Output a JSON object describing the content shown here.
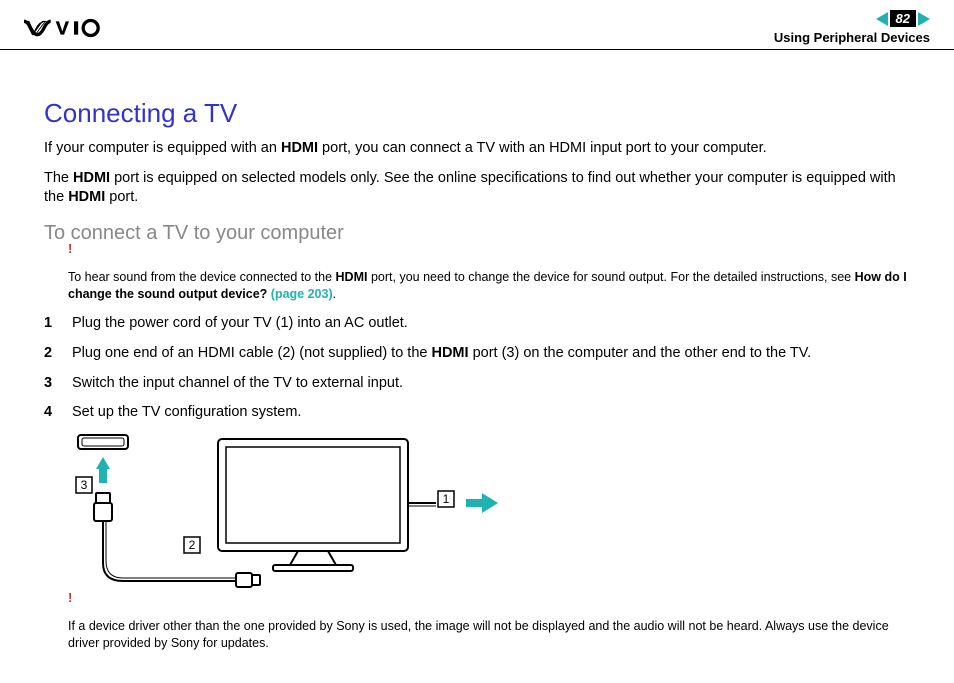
{
  "header": {
    "page_number": "82",
    "breadcrumb": "Using Peripheral Devices"
  },
  "title": "Connecting a TV",
  "para1_a": "If your computer is equipped with an ",
  "para1_b": "HDMI",
  "para1_c": " port, you can connect a TV with an HDMI input port to your computer.",
  "para2_a": "The ",
  "para2_b": "HDMI",
  "para2_c": " port is equipped on selected models only. See the online specifications to find out whether your computer is equipped with the ",
  "para2_d": "HDMI",
  "para2_e": " port.",
  "subtitle": "To connect a TV to your computer",
  "note1_mark": "!",
  "note1_a": "To hear sound from the device connected to the ",
  "note1_b": "HDMI",
  "note1_c": " port, you need to change the device for sound output. For the detailed instructions, see ",
  "note1_d": "How do I change the sound output device? ",
  "note1_e": "(page 203)",
  "note1_f": ".",
  "steps": [
    {
      "n": "1",
      "text_a": "Plug the power cord of your TV (1) into an AC outlet.",
      "text_b": "",
      "text_c": ""
    },
    {
      "n": "2",
      "text_a": "Plug one end of an HDMI cable (2) (not supplied) to the ",
      "text_b": "HDMI",
      "text_c": " port (3) on the computer and the other end to the TV."
    },
    {
      "n": "3",
      "text_a": "Switch the input channel of the TV to external input.",
      "text_b": "",
      "text_c": ""
    },
    {
      "n": "4",
      "text_a": "Set up the TV configuration system.",
      "text_b": "",
      "text_c": ""
    }
  ],
  "diagram_labels": {
    "l1": "1",
    "l2": "2",
    "l3": "3"
  },
  "note2_mark": "!",
  "note2": "If a device driver other than the one provided by Sony is used, the image will not be displayed and the audio will not be heard. Always use the device driver provided by Sony for updates."
}
